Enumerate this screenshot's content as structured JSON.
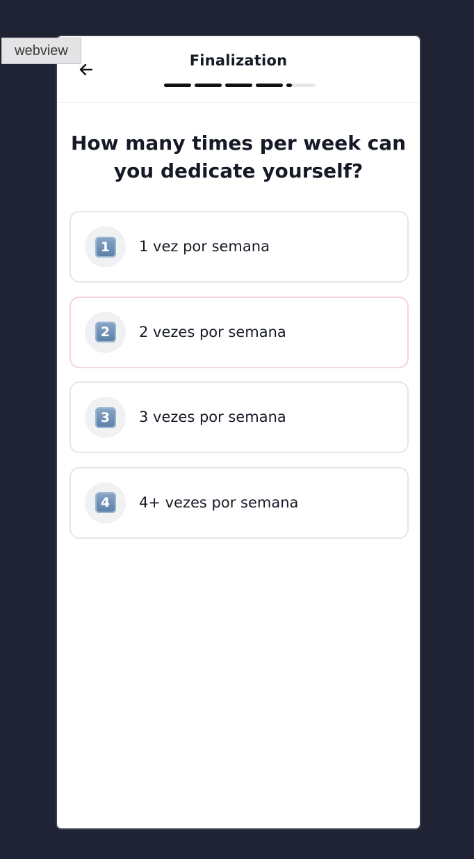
{
  "webview_tag": "webview",
  "header": {
    "title": "Finalization",
    "back_icon": "arrow-left-icon",
    "progress": {
      "total_steps": 5,
      "completed_steps": 4,
      "current_step_fraction": 0.2
    }
  },
  "question": "How many times per week can you dedicate yourself?",
  "options": [
    {
      "badge": "1",
      "label": "1 vez por semana",
      "highlighted": false
    },
    {
      "badge": "2",
      "label": "2 vezes por semana",
      "highlighted": true
    },
    {
      "badge": "3",
      "label": "3 vezes por semana",
      "highlighted": false
    },
    {
      "badge": "4",
      "label": "4+ vezes por semana",
      "highlighted": false
    }
  ],
  "colors": {
    "background": "#1f2333",
    "card": "#ffffff",
    "highlight_border": "#f4d3da",
    "option_border": "#e6e6e8",
    "text": "#161a26"
  }
}
